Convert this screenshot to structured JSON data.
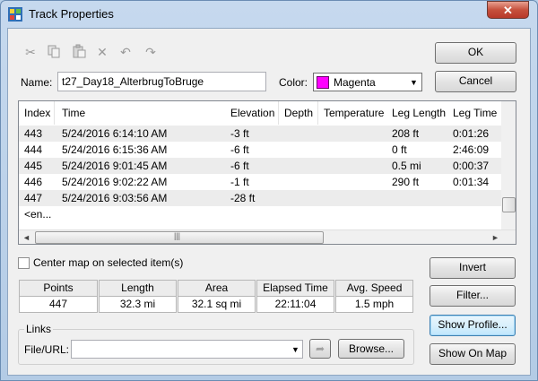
{
  "window": {
    "title": "Track Properties",
    "close_label": "✕"
  },
  "toolbar": {
    "icons": [
      "cut-icon",
      "copy-icon",
      "paste-icon",
      "delete-icon",
      "undo-icon",
      "redo-icon"
    ]
  },
  "buttons": {
    "ok": "OK",
    "cancel": "Cancel",
    "invert": "Invert",
    "filter": "Filter...",
    "show_profile": "Show Profile...",
    "show_on_map": "Show On Map",
    "browse": "Browse..."
  },
  "name_field": {
    "label": "Name:",
    "value": "t27_Day18_AlterbrugToBruge"
  },
  "color_field": {
    "label": "Color:",
    "value": "Magenta",
    "swatch": "#ff00ff"
  },
  "table": {
    "columns": [
      "Index",
      "Time",
      "Elevation",
      "Depth",
      "Temperature",
      "Leg Length",
      "Leg Time"
    ],
    "rows": [
      [
        "443",
        "5/24/2016 6:14:10 AM",
        "-3 ft",
        "",
        "",
        "208 ft",
        "0:01:26"
      ],
      [
        "444",
        "5/24/2016 6:15:36 AM",
        "-6 ft",
        "",
        "",
        "0 ft",
        "2:46:09"
      ],
      [
        "445",
        "5/24/2016 9:01:45 AM",
        "-6 ft",
        "",
        "",
        "0.5 mi",
        "0:00:37"
      ],
      [
        "446",
        "5/24/2016 9:02:22 AM",
        "-1 ft",
        "",
        "",
        "290 ft",
        "0:01:34"
      ],
      [
        "447",
        "5/24/2016 9:03:56 AM",
        "-28 ft",
        "",
        "",
        "",
        ""
      ]
    ],
    "end_row": "<en..."
  },
  "center_map": {
    "label": "Center map on selected item(s)",
    "checked": false
  },
  "stats": {
    "headers": [
      "Points",
      "Length",
      "Area",
      "Elapsed Time",
      "Avg. Speed"
    ],
    "values": [
      "447",
      "32.3 mi",
      "32.1 sq mi",
      "22:11:04",
      "1.5 mph"
    ]
  },
  "links": {
    "group_label": "Links",
    "field_label": "File/URL:",
    "value": ""
  }
}
